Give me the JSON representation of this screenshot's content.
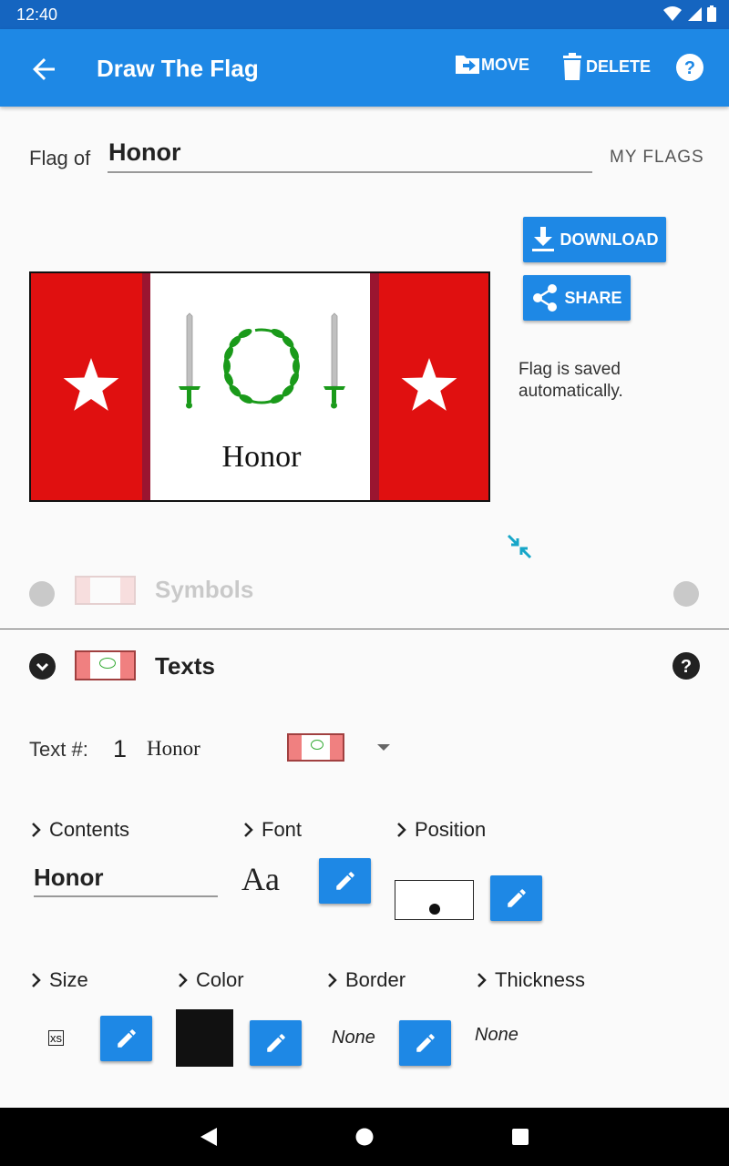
{
  "status_bar": {
    "time": "12:40"
  },
  "app_bar": {
    "title": "Draw The Flag",
    "move_label": "MOVE",
    "delete_label": "DELETE",
    "accent": "#1e88e5"
  },
  "flag_name": {
    "prefix": "Flag of",
    "value": "Honor",
    "my_flags_label": "MY FLAGS"
  },
  "flag_preview": {
    "text": "Honor",
    "colors": {
      "side": "#e01010",
      "stripe": "#9a1530",
      "center": "#ffffff",
      "laurel": "#1a9a1a",
      "sword": "#c0c0c0",
      "hilt": "#1a9a1a"
    }
  },
  "actions": {
    "download_label": "DOWNLOAD",
    "share_label": "SHARE",
    "saved_note": "Flag is saved automatically."
  },
  "collapsed_section": {
    "title": "Symbols"
  },
  "texts_section": {
    "title": "Texts",
    "text_num_label": "Text #:",
    "text_num": "1",
    "text_value": "Honor",
    "contents_label": "Contents",
    "contents_value": "Honor",
    "font_label": "Font",
    "font_sample": "Aa",
    "position_label": "Position",
    "size_label": "Size",
    "size_value": "xs",
    "color_label": "Color",
    "color_value": "#111111",
    "border_label": "Border",
    "border_value": "None",
    "thickness_label": "Thickness",
    "thickness_value": "None"
  }
}
